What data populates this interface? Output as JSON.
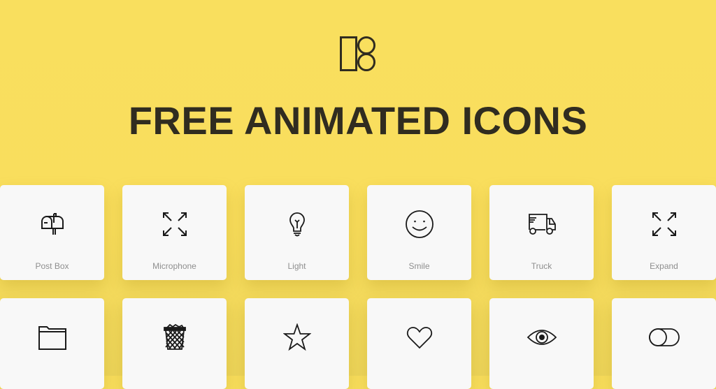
{
  "header": {
    "logo": "brand-logo-icon",
    "title": "FREE ANIMATED ICONS"
  },
  "colors": {
    "background": "#f9de5d",
    "title": "#302c20",
    "card": "#f8f8f8",
    "label": "#8e8e8e",
    "icon_stroke": "#1a1a1a"
  },
  "icons": [
    {
      "label": "Post Box",
      "icon": "mailbox-icon"
    },
    {
      "label": "Microphone",
      "icon": "expand-arrows-icon"
    },
    {
      "label": "Light",
      "icon": "lightbulb-icon"
    },
    {
      "label": "Smile",
      "icon": "smile-icon"
    },
    {
      "label": "Truck",
      "icon": "truck-icon"
    },
    {
      "label": "Expand",
      "icon": "expand-arrows-icon"
    },
    {
      "label": "",
      "icon": "folder-icon"
    },
    {
      "label": "",
      "icon": "trash-bin-icon"
    },
    {
      "label": "",
      "icon": "star-icon"
    },
    {
      "label": "",
      "icon": "heart-icon"
    },
    {
      "label": "",
      "icon": "eye-icon"
    },
    {
      "label": "",
      "icon": "toggle-icon"
    }
  ]
}
